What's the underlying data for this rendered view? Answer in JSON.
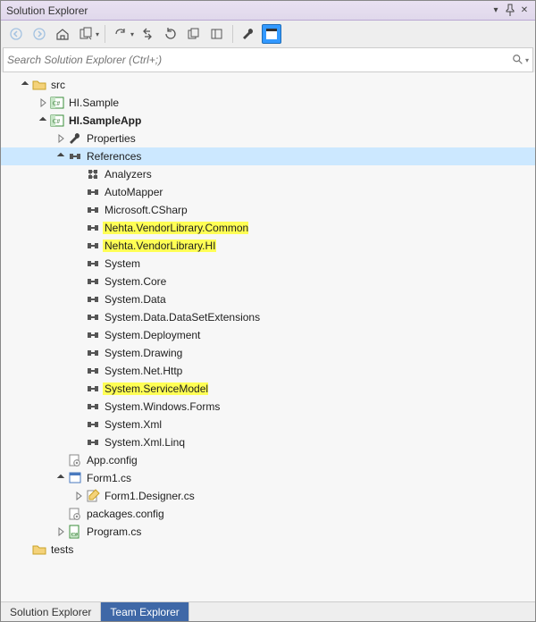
{
  "panel": {
    "title": "Solution Explorer"
  },
  "search": {
    "placeholder": "Search Solution Explorer (Ctrl+;)"
  },
  "tabs": [
    {
      "label": "Solution Explorer",
      "active": true
    },
    {
      "label": "Team Explorer",
      "active": false
    }
  ],
  "tree": [
    {
      "depth": 0,
      "arrow": "open",
      "icon": "folder",
      "label": "src",
      "bold": false
    },
    {
      "depth": 1,
      "arrow": "closed",
      "icon": "csproj",
      "label": "HI.Sample",
      "bold": false
    },
    {
      "depth": 1,
      "arrow": "open",
      "icon": "csproj",
      "label": "HI.SampleApp",
      "bold": true
    },
    {
      "depth": 2,
      "arrow": "closed",
      "icon": "wrench",
      "label": "Properties",
      "bold": false
    },
    {
      "depth": 2,
      "arrow": "open",
      "icon": "ref",
      "label": "References",
      "bold": false,
      "selected": true
    },
    {
      "depth": 3,
      "arrow": "",
      "icon": "analyzer",
      "label": "Analyzers",
      "bold": false
    },
    {
      "depth": 3,
      "arrow": "",
      "icon": "ref",
      "label": "AutoMapper",
      "bold": false
    },
    {
      "depth": 3,
      "arrow": "",
      "icon": "ref",
      "label": "Microsoft.CSharp",
      "bold": false
    },
    {
      "depth": 3,
      "arrow": "",
      "icon": "ref",
      "label": "Nehta.VendorLibrary.Common",
      "bold": false,
      "highlight": true
    },
    {
      "depth": 3,
      "arrow": "",
      "icon": "ref",
      "label": "Nehta.VendorLibrary.HI",
      "bold": false,
      "highlight": true
    },
    {
      "depth": 3,
      "arrow": "",
      "icon": "ref",
      "label": "System",
      "bold": false
    },
    {
      "depth": 3,
      "arrow": "",
      "icon": "ref",
      "label": "System.Core",
      "bold": false
    },
    {
      "depth": 3,
      "arrow": "",
      "icon": "ref",
      "label": "System.Data",
      "bold": false
    },
    {
      "depth": 3,
      "arrow": "",
      "icon": "ref",
      "label": "System.Data.DataSetExtensions",
      "bold": false
    },
    {
      "depth": 3,
      "arrow": "",
      "icon": "ref",
      "label": "System.Deployment",
      "bold": false
    },
    {
      "depth": 3,
      "arrow": "",
      "icon": "ref",
      "label": "System.Drawing",
      "bold": false
    },
    {
      "depth": 3,
      "arrow": "",
      "icon": "ref",
      "label": "System.Net.Http",
      "bold": false
    },
    {
      "depth": 3,
      "arrow": "",
      "icon": "ref",
      "label": "System.ServiceModel",
      "bold": false,
      "highlight": true
    },
    {
      "depth": 3,
      "arrow": "",
      "icon": "ref",
      "label": "System.Windows.Forms",
      "bold": false
    },
    {
      "depth": 3,
      "arrow": "",
      "icon": "ref",
      "label": "System.Xml",
      "bold": false
    },
    {
      "depth": 3,
      "arrow": "",
      "icon": "ref",
      "label": "System.Xml.Linq",
      "bold": false
    },
    {
      "depth": 2,
      "arrow": "",
      "icon": "config",
      "label": "App.config",
      "bold": false
    },
    {
      "depth": 2,
      "arrow": "open",
      "icon": "form",
      "label": "Form1.cs",
      "bold": false
    },
    {
      "depth": 3,
      "arrow": "closed",
      "icon": "designer",
      "label": "Form1.Designer.cs",
      "bold": false
    },
    {
      "depth": 2,
      "arrow": "",
      "icon": "config",
      "label": "packages.config",
      "bold": false
    },
    {
      "depth": 2,
      "arrow": "closed",
      "icon": "csfile",
      "label": "Program.cs",
      "bold": false
    },
    {
      "depth": 0,
      "arrow": "",
      "icon": "folder",
      "label": "tests",
      "bold": false
    }
  ]
}
